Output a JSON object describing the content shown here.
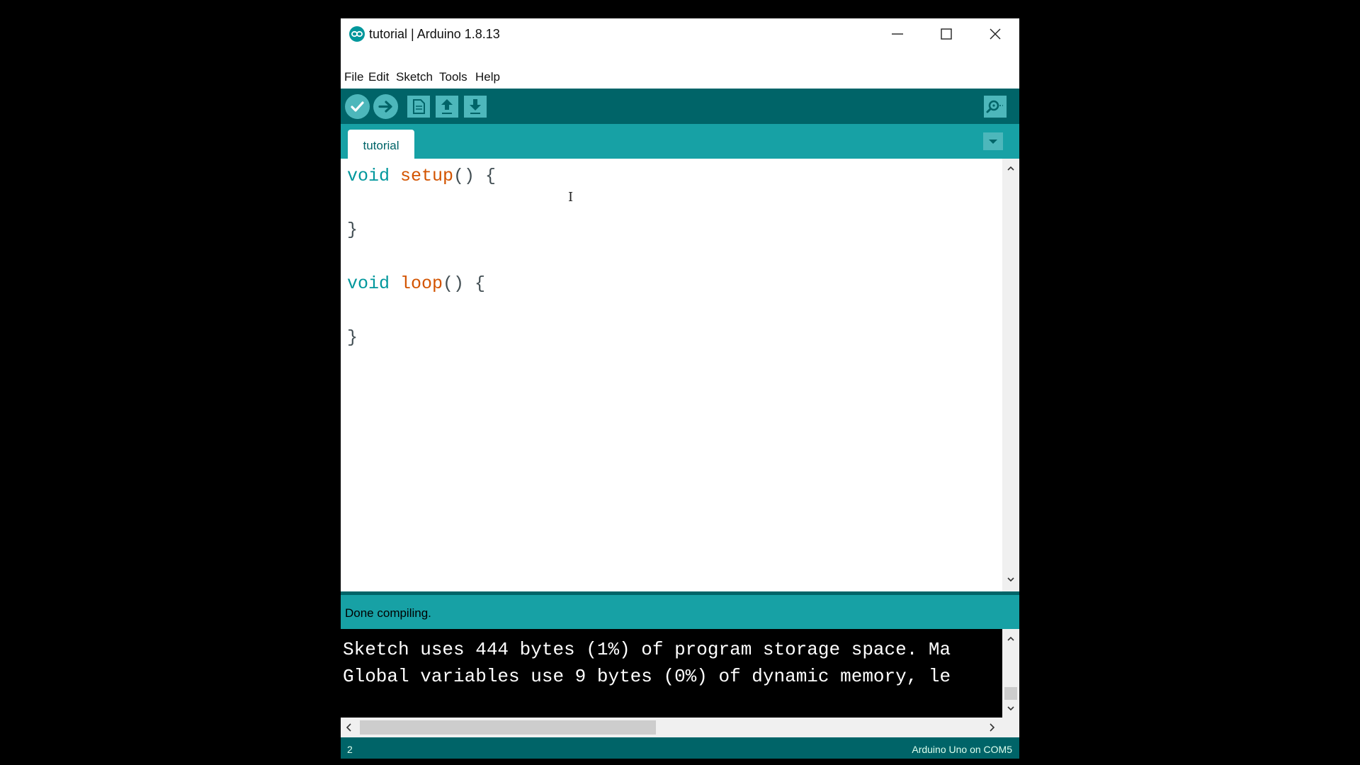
{
  "window": {
    "title": "tutorial | Arduino 1.8.13"
  },
  "menubar": {
    "items": [
      "File",
      "Edit",
      "Sketch",
      "Tools",
      "Help"
    ]
  },
  "toolbar": {
    "buttons": [
      "verify-icon",
      "upload-icon",
      "new-icon",
      "open-icon",
      "save-icon",
      "serial-monitor-icon"
    ]
  },
  "tabs": [
    {
      "label": "tutorial",
      "active": true
    }
  ],
  "editor": {
    "lines": [
      {
        "kw": "void",
        "fn": "setup",
        "rest": "() {"
      },
      {
        "text": ""
      },
      {
        "text": "}"
      },
      {
        "text": ""
      },
      {
        "kw": "void",
        "fn": "loop",
        "rest": "() {"
      },
      {
        "text": ""
      },
      {
        "text": "}"
      }
    ],
    "cursor_glyph": "I"
  },
  "status": {
    "message": "Done compiling."
  },
  "console": {
    "lines": [
      "Sketch uses 444 bytes (1%) of program storage space. Ma",
      "Global variables use 9 bytes (0%) of dynamic memory, le"
    ]
  },
  "footer": {
    "line_number": "2",
    "board": "Arduino Uno on COM5"
  },
  "colors": {
    "toolbar_bg": "#006468",
    "tab_bar_bg": "#17a1a5",
    "button_bg": "#4db7bb",
    "keyword": "#00979c",
    "function": "#d35400"
  }
}
